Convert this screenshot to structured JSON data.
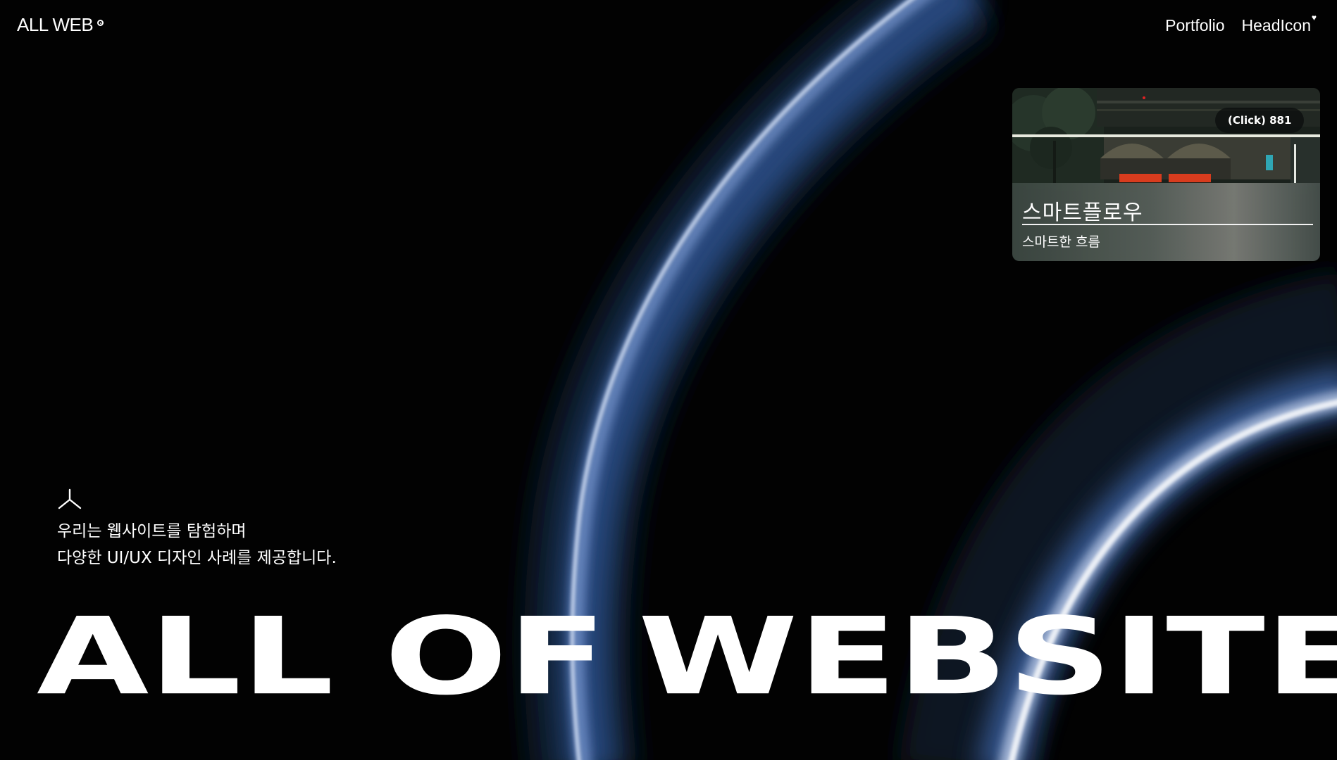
{
  "header": {
    "logo_text": "ALL WEB",
    "nav": [
      {
        "label": "Portfolio"
      },
      {
        "label": "HeadIcon",
        "icon": "heart-icon"
      }
    ]
  },
  "card": {
    "click_label": "(Click) 881",
    "title": "스마트플로우",
    "subtitle": "스마트한 흐름",
    "image": "night-station-photo"
  },
  "intro": {
    "icon": "branch-icon",
    "line1": "우리는 웹사이트를 탐험하며",
    "line2": "다양한 UI/UX 디자인 사례를 제공합니다."
  },
  "hero": {
    "word1": "ALL OF",
    "word2": "WEBSITE"
  },
  "colors": {
    "background": "#020202",
    "ring_glow": "#6f8fc8",
    "text": "#ffffff"
  }
}
